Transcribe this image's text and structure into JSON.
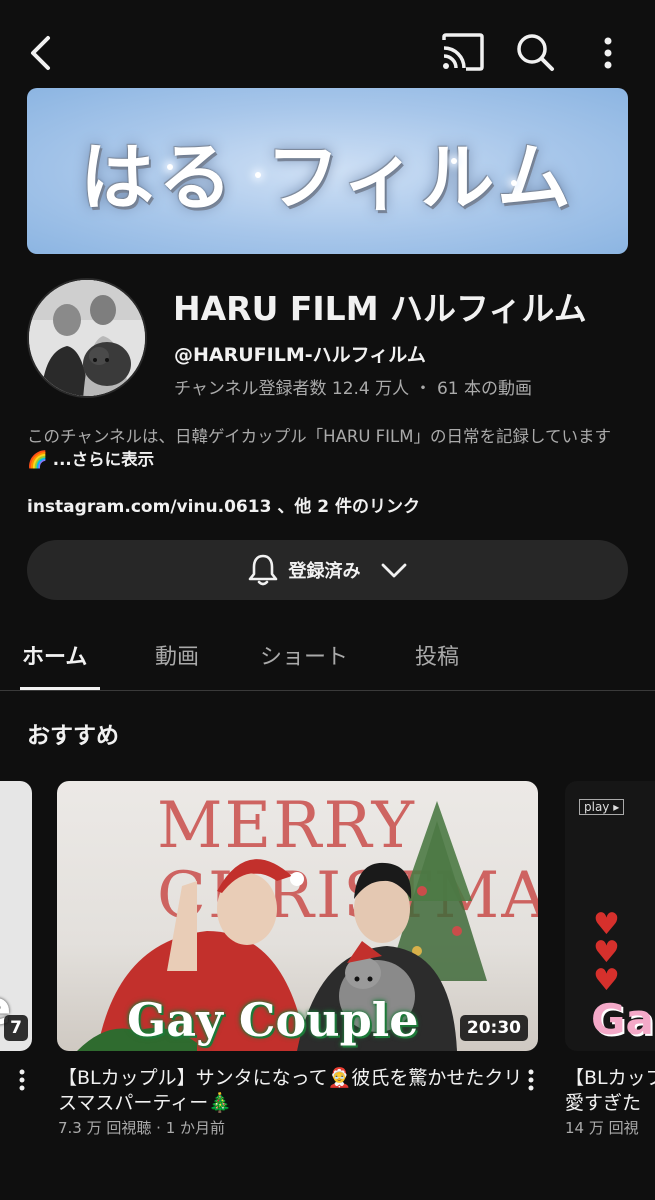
{
  "topbar": {
    "back_icon": "back-arrow-icon",
    "cast_icon": "cast-icon",
    "search_icon": "search-icon",
    "more_icon": "more-vert-icon"
  },
  "banner": {
    "text": "はる フィルム"
  },
  "channel": {
    "name": "HARU FILM ハルフィルム",
    "handle": "@HARUFILM-ハルフィルム",
    "stats": "チャンネル登録者数 12.4 万人 ・ 61 本の動画",
    "description": "このチャンネルは、日韓ゲイカップル「HARU FILM」の日常を記録しています🌈",
    "more_label": "...さらに表示",
    "links": "instagram.com/vinu.0613 、他 2 件のリンク"
  },
  "subscribe": {
    "label": "登録済み",
    "bell_icon": "bell-icon",
    "chevron_icon": "chevron-down-icon"
  },
  "tabs": [
    {
      "label": "ホーム",
      "active": true
    },
    {
      "label": "動画",
      "active": false
    },
    {
      "label": "ショート",
      "active": false
    },
    {
      "label": "投稿",
      "active": false
    }
  ],
  "section": {
    "title": "おすすめ"
  },
  "videos": {
    "left": {
      "duration_partial": "7",
      "thumb_text_partial": "e"
    },
    "main": {
      "thumb_caption": "Gay Couple",
      "thumb_heading": "MERRY CHRISTMAS",
      "duration": "20:30",
      "title": "【BLカップル】サンタになって🤶彼氏を驚かせたクリスマスパーティー🎄",
      "meta": "7.3 万 回視聴 · 1 か月前"
    },
    "right": {
      "thumb_tag": "play ▸",
      "thumb_caption": "Ga",
      "title_line1": "【BLカップ",
      "title_line2": "愛すぎた",
      "meta": "14 万 回視"
    }
  },
  "colors": {
    "background": "#0f0f0f",
    "surface": "#272727",
    "text": "#f1f1f1",
    "muted": "#aaaaaa",
    "banner": "#a7c6ea"
  }
}
